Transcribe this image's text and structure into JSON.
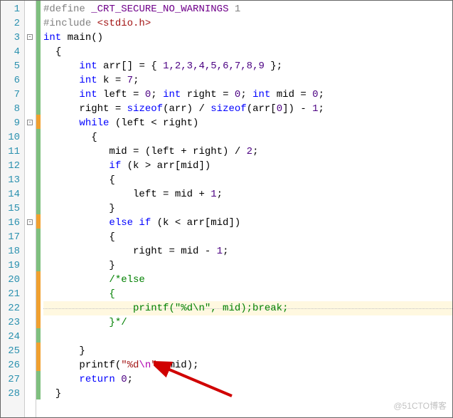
{
  "watermark": "@51CTO博客",
  "lines": [
    {
      "n": 1,
      "change": "green"
    },
    {
      "n": 2,
      "change": "green"
    },
    {
      "n": 3,
      "change": "green",
      "fold": "-",
      "foldTop": 5
    },
    {
      "n": 4,
      "change": "green"
    },
    {
      "n": 5,
      "change": "green"
    },
    {
      "n": 6,
      "change": "green"
    },
    {
      "n": 7,
      "change": "green"
    },
    {
      "n": 8,
      "change": "green"
    },
    {
      "n": 9,
      "change": "orange",
      "fold": "-",
      "foldTop": 5
    },
    {
      "n": 10,
      "change": "green"
    },
    {
      "n": 11,
      "change": "green"
    },
    {
      "n": 12,
      "change": "green"
    },
    {
      "n": 13,
      "change": "green"
    },
    {
      "n": 14,
      "change": "green"
    },
    {
      "n": 15,
      "change": "green"
    },
    {
      "n": 16,
      "change": "orange",
      "fold": "-",
      "foldTop": 5
    },
    {
      "n": 17,
      "change": "green"
    },
    {
      "n": 18,
      "change": "green"
    },
    {
      "n": 19,
      "change": "green"
    },
    {
      "n": 20,
      "change": "orange"
    },
    {
      "n": 21,
      "change": "orange"
    },
    {
      "n": 22,
      "change": "orange",
      "hl": true,
      "dotted": true
    },
    {
      "n": 23,
      "change": "orange"
    },
    {
      "n": 24,
      "change": "green"
    },
    {
      "n": 25,
      "change": "orange"
    },
    {
      "n": 26,
      "change": "orange"
    },
    {
      "n": 27,
      "change": "green"
    },
    {
      "n": 28,
      "change": "green"
    }
  ],
  "code": {
    "l1": {
      "hash": "#",
      "define": "define",
      "sp": " ",
      "macro": "_CRT_SECURE_NO_WARNINGS",
      "tail": " 1"
    },
    "l2": {
      "hash": "#",
      "include": "include",
      "sp": " ",
      "hdr": "<stdio.h>"
    },
    "l3": {
      "kw": "int",
      "sp": " ",
      "fn": "main",
      "p": "()"
    },
    "l4": {
      "ind": "  ",
      "b": "{"
    },
    "l5": {
      "ind": "      ",
      "kw": "int",
      "rest": " arr[] = { ",
      "nums": "1,2,3,4,5,6,7,8,9",
      "tail": " };"
    },
    "l6": {
      "ind": "      ",
      "kw": "int",
      "rest": " k = ",
      "val": "7",
      "sc": ";"
    },
    "l7": {
      "ind": "      ",
      "kw1": "int",
      "sp1": " left = ",
      "v1": "0",
      "sc1": "; ",
      "kw2": "int",
      "sp2": " right = ",
      "v2": "0",
      "sc2": "; ",
      "kw3": "int",
      "sp3": " mid = ",
      "v3": "0",
      "sc3": ";"
    },
    "l8": {
      "ind": "      ",
      "t1": "right = ",
      "so1": "sizeof",
      "t2": "(arr) / ",
      "so2": "sizeof",
      "t3": "(arr[",
      "z": "0",
      "t4": "]) - ",
      "one": "1",
      "sc": ";"
    },
    "l9": {
      "ind": "      ",
      "kw": "while",
      "rest": " (left < right)"
    },
    "l10": {
      "ind": "        ",
      "b": "{"
    },
    "l11": {
      "ind": "           ",
      "t1": "mid = (left + right) / ",
      "two": "2",
      "sc": ";"
    },
    "l12": {
      "ind": "           ",
      "kw": "if",
      "rest": " (k > arr[mid])"
    },
    "l13": {
      "ind": "           ",
      "b": "{"
    },
    "l14": {
      "ind": "               ",
      "t": "left = mid + ",
      "one": "1",
      "sc": ";"
    },
    "l15": {
      "ind": "           ",
      "b": "}"
    },
    "l16": {
      "ind": "           ",
      "kw": "else if",
      "rest": " (k < arr[mid])"
    },
    "l17": {
      "ind": "           ",
      "b": "{"
    },
    "l18": {
      "ind": "               ",
      "t": "right = mid - ",
      "one": "1",
      "sc": ";"
    },
    "l19": {
      "ind": "           ",
      "b": "}"
    },
    "l20": {
      "ind": "           ",
      "c": "/*else"
    },
    "l21": {
      "ind": "           ",
      "c": "{"
    },
    "l22": {
      "ind": "               ",
      "c": "printf(\"%d\\n\", mid);break;"
    },
    "l23": {
      "ind": "           ",
      "c": "}*/"
    },
    "l24": {
      "ind": ""
    },
    "l25": {
      "ind": "      ",
      "b": "}"
    },
    "l26": {
      "ind": "      ",
      "fn": "printf",
      "p1": "(",
      "q1": "\"",
      "fmt": "%d",
      "esc": "\\n",
      "q2": "\"",
      "rest": ", mid);"
    },
    "l27": {
      "ind": "      ",
      "kw": "return",
      "sp": " ",
      "z": "0",
      "sc": ";"
    },
    "l28": {
      "ind": "  ",
      "b": "}"
    }
  }
}
